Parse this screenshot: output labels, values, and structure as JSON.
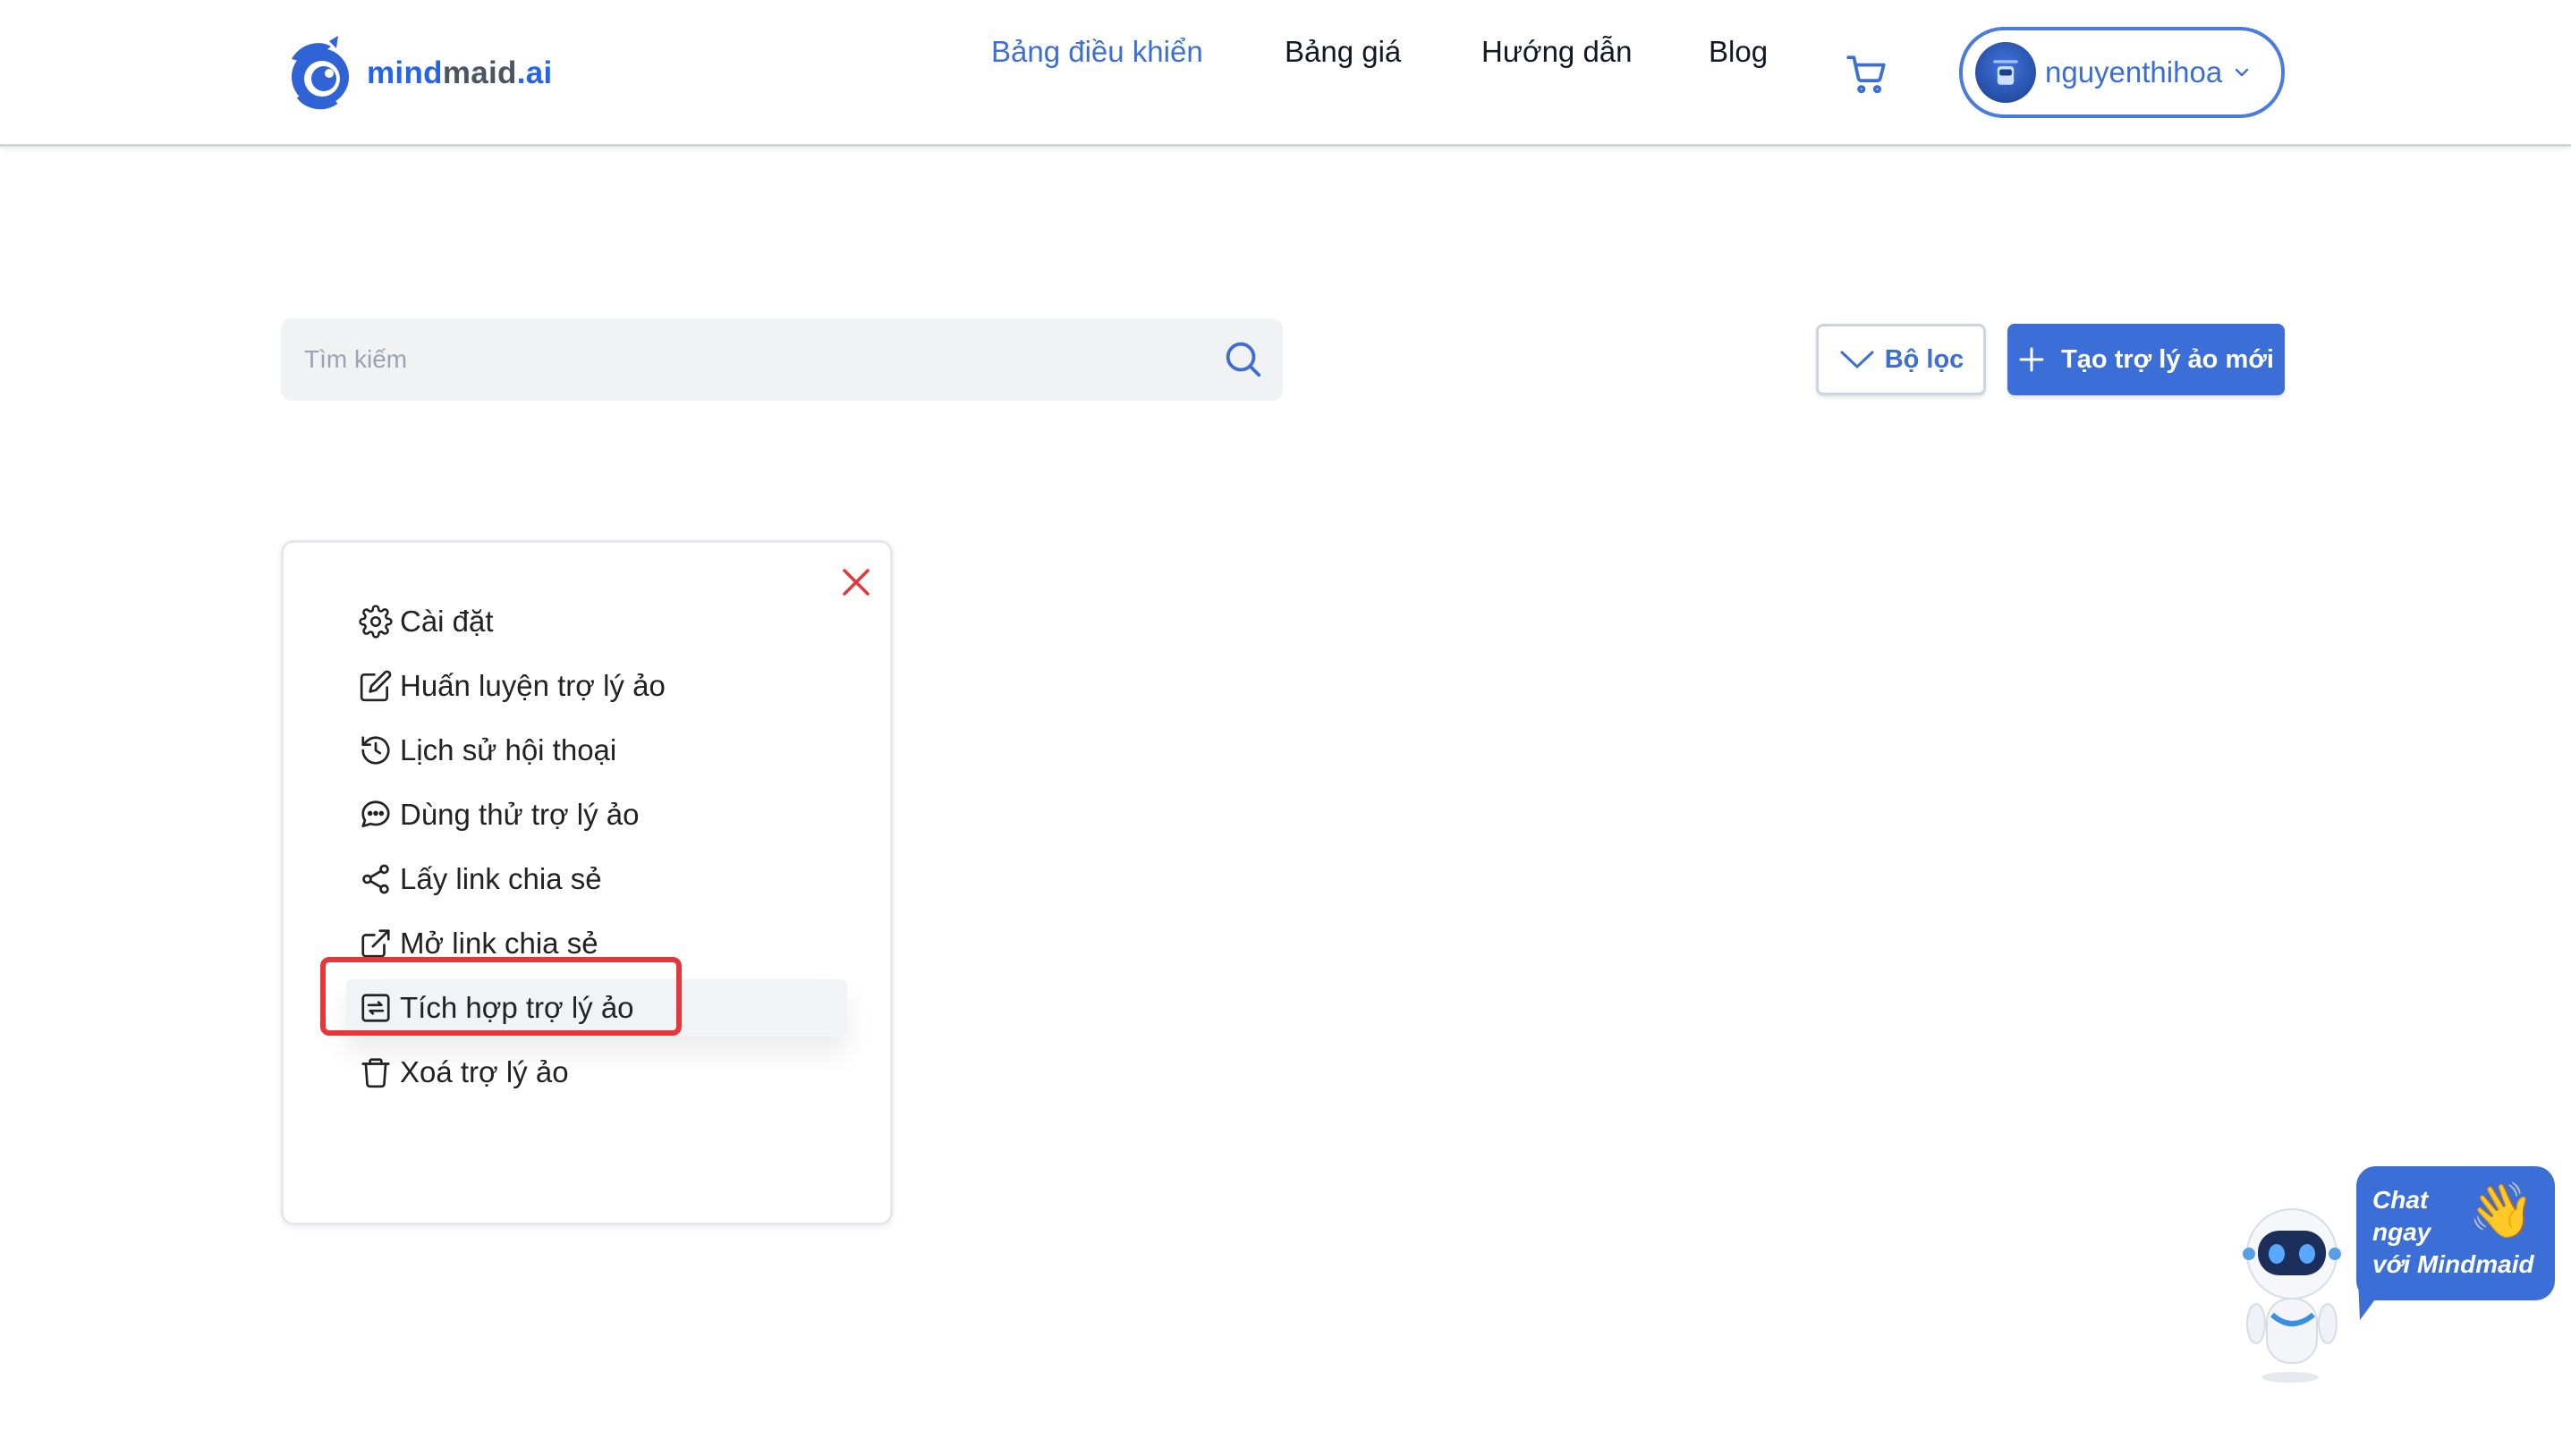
{
  "brand": {
    "part1": "mind",
    "part2": "maid",
    "part3": ".ai"
  },
  "nav": {
    "dashboard": "Bảng điều khiển",
    "pricing": "Bảng giá",
    "guide": "Hướng dẫn",
    "blog": "Blog"
  },
  "user": {
    "name": "nguyenthihoa"
  },
  "search": {
    "placeholder": "Tìm kiếm",
    "value": ""
  },
  "toolbar": {
    "filter_label": "Bộ lọc",
    "create_label": "Tạo trợ lý ảo mới"
  },
  "menu": {
    "items": [
      {
        "label": "Cài đặt",
        "icon": "gear-icon"
      },
      {
        "label": "Huấn luyện trợ lý ảo",
        "icon": "edit-icon"
      },
      {
        "label": "Lịch sử hội thoại",
        "icon": "history-icon"
      },
      {
        "label": "Dùng thử trợ lý ảo",
        "icon": "chat-icon"
      },
      {
        "label": "Lấy link chia sẻ",
        "icon": "share-icon"
      },
      {
        "label": "Mở link chia sẻ",
        "icon": "external-link-icon"
      },
      {
        "label": "Tích hợp trợ lý ảo",
        "icon": "integration-icon"
      },
      {
        "label": "Xoá trợ lý ảo",
        "icon": "trash-icon"
      }
    ]
  },
  "chat_widget": {
    "line1": "Chat",
    "line2": "ngay",
    "line3": "với Mindmaid",
    "emoji": "👋"
  },
  "colors": {
    "accent": "#3b6ed6",
    "close": "#e5363a",
    "highlight": "#e5363a"
  }
}
